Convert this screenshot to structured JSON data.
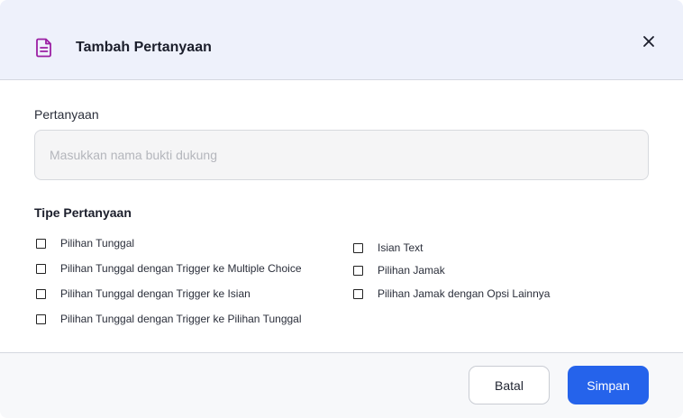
{
  "header": {
    "icon": "document-icon",
    "title": "Tambah Pertanyaan",
    "close_icon": "close-icon"
  },
  "question_field": {
    "label": "Pertanyaan",
    "value": "",
    "placeholder": "Masukkan nama bukti dukung"
  },
  "question_type": {
    "title": "Tipe Pertanyaan",
    "options_left": [
      {
        "label": "Pilihan Tunggal",
        "checked": false
      },
      {
        "label": "Pilihan Tunggal dengan Trigger ke Multiple Choice",
        "checked": false
      },
      {
        "label": "Pilihan Tunggal dengan Trigger ke Isian",
        "checked": false
      },
      {
        "label": "Pilihan Tunggal dengan Trigger ke Pilihan Tunggal",
        "checked": false
      }
    ],
    "options_right": [
      {
        "label": "Isian Text",
        "checked": false
      },
      {
        "label": "Pilihan Jamak",
        "checked": false
      },
      {
        "label": "Pilihan Jamak dengan Opsi Lainnya",
        "checked": false
      }
    ]
  },
  "footer": {
    "cancel_label": "Batal",
    "save_label": "Simpan"
  },
  "colors": {
    "accent": "#2563eb",
    "header_icon": "#9b1fa3",
    "header_bg": "#eef1fb"
  }
}
